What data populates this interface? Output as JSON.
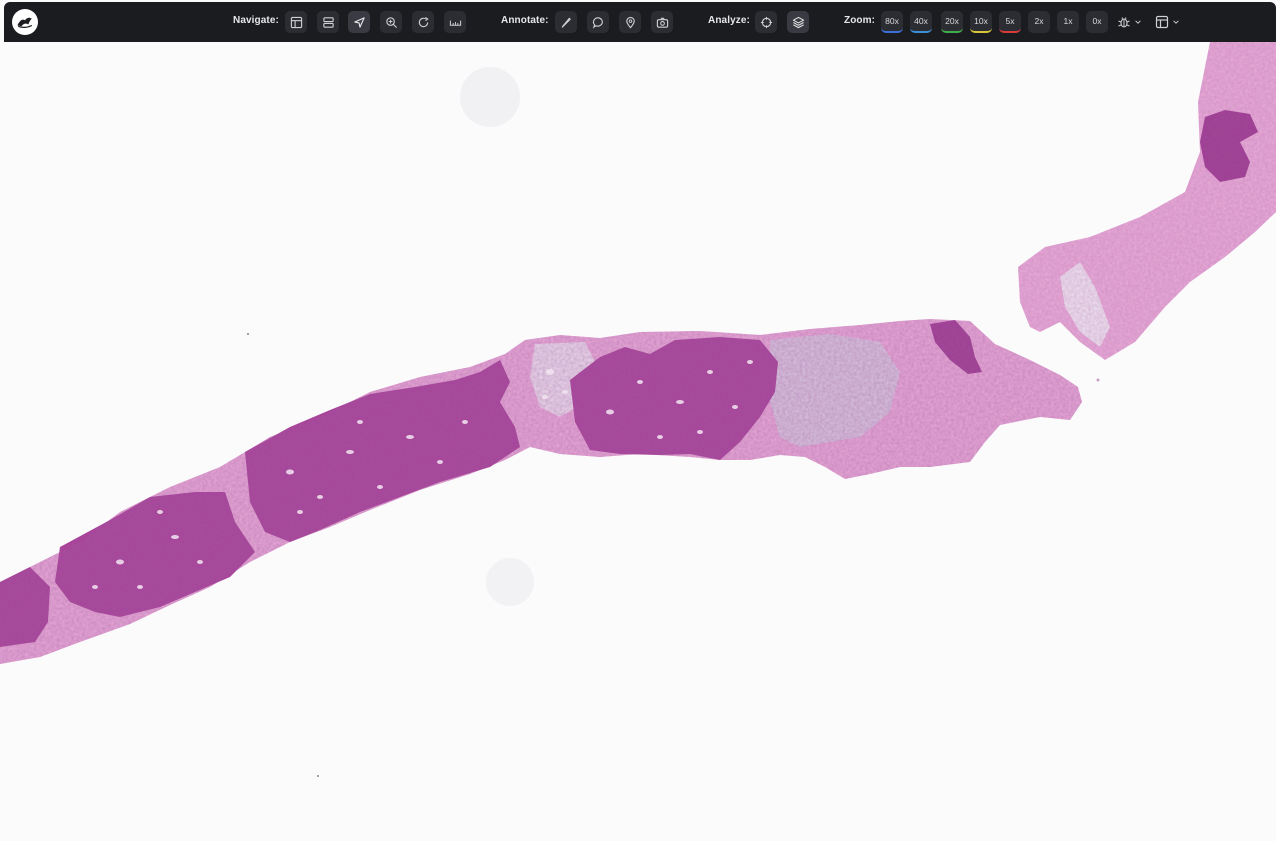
{
  "toolbar": {
    "navigate_label": "Navigate:",
    "annotate_label": "Annotate:",
    "analyze_label": "Analyze:",
    "zoom_label": "Zoom:",
    "navigate_tools": [
      "layout-icon",
      "rows-icon",
      "pointer-icon",
      "zoom-in-icon",
      "rotate-icon",
      "ruler-icon"
    ],
    "annotate_tools": [
      "pen-icon",
      "comment-icon",
      "pin-icon",
      "camera-icon"
    ],
    "analyze_tools": [
      "crosshair-icon",
      "layers-icon"
    ],
    "zoom_levels": [
      {
        "label": "80x",
        "color": "#3b6fd6"
      },
      {
        "label": "40x",
        "color": "#3a8fd8"
      },
      {
        "label": "20x",
        "color": "#3fae4a"
      },
      {
        "label": "10x",
        "color": "#d8c53a"
      },
      {
        "label": "5x",
        "color": "#d83a3a"
      },
      {
        "label": "2x",
        "color": "#2c2d33"
      },
      {
        "label": "1x",
        "color": "#2c2d33"
      },
      {
        "label": "0x",
        "color": "#2c2d33"
      }
    ],
    "right_tools": [
      "bug-icon",
      "panel-layout-icon"
    ]
  },
  "viewer": {
    "background": "#fbfbfc",
    "tissue_color": "#e7a9d6",
    "tumor_color": "#a8459a"
  }
}
